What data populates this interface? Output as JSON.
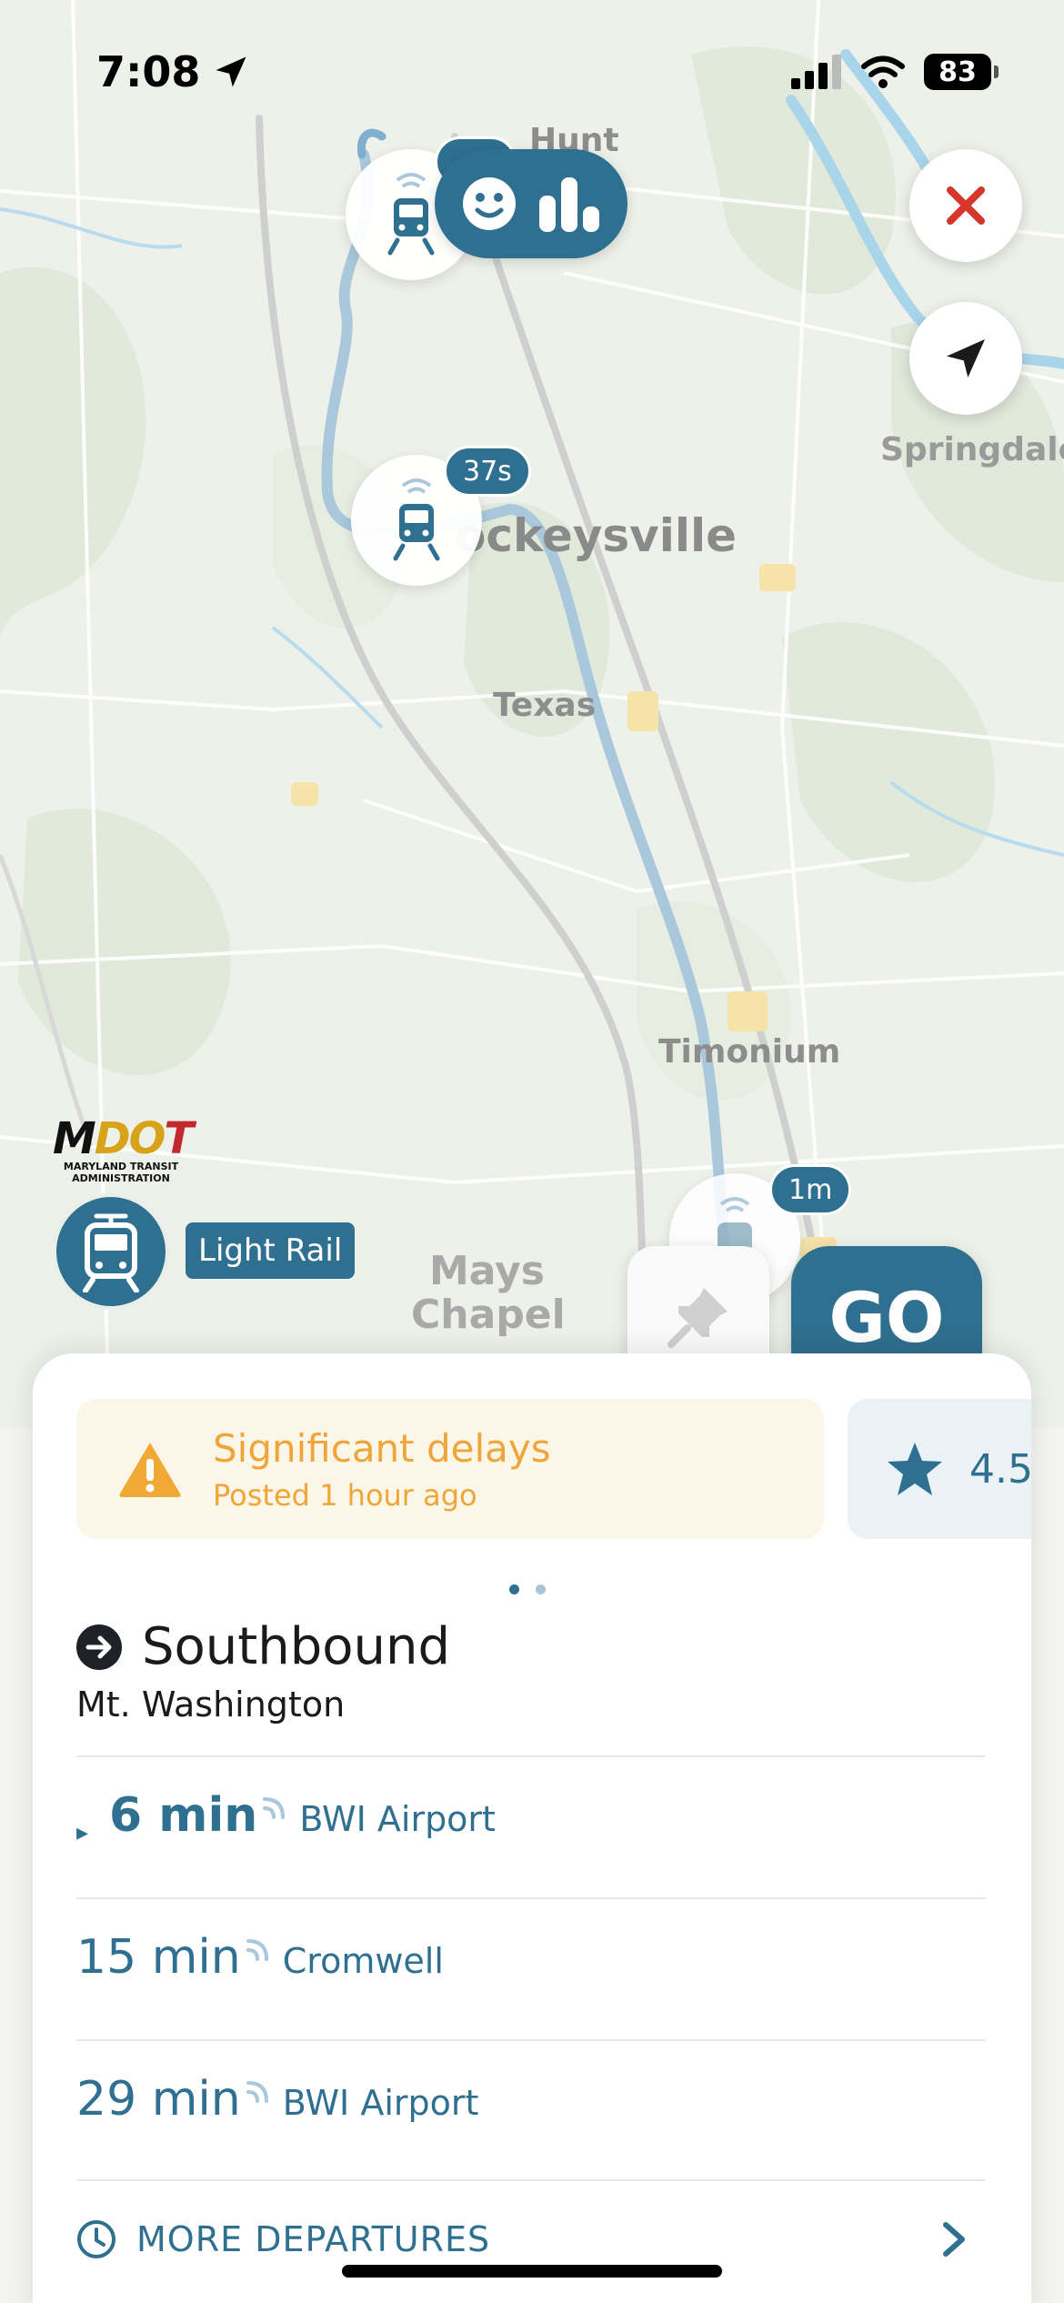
{
  "status_bar": {
    "time": "7:08",
    "battery": "83"
  },
  "map": {
    "places": {
      "hunt": "Hunt",
      "springdale": "Springdale",
      "cockeysville": "ockeysville",
      "texas": "Texas",
      "timonium": "Timonium",
      "mays": "Mays",
      "chapel": "Chapel"
    },
    "vehicles": [
      {
        "eta": ""
      },
      {
        "eta": "37s"
      },
      {
        "eta": "1m"
      }
    ],
    "operator_logo": {
      "mark_left": "M",
      "mark_mid": "D",
      "mark_o": "O",
      "mark_right": "T",
      "line1": "MARYLAND TRANSIT",
      "line2": "ADMINISTRATION"
    },
    "route_label": "Light Rail",
    "go_label": "GO",
    "icons": {
      "close": "close-icon",
      "locate": "location-arrow-icon",
      "crowd": "crowdsourcing-icon",
      "pin": "pushpin-icon",
      "tram": "tram-icon"
    },
    "colors": {
      "accent": "#2f6f8f",
      "route_line": "#a9c8dc",
      "close_red": "#d6352b"
    }
  },
  "sheet": {
    "alert": {
      "title": "Significant delays",
      "posted": "Posted 1 hour ago",
      "color": "#efa638"
    },
    "rating": {
      "value": "4.5"
    },
    "pager": {
      "count": 2,
      "active": 0
    },
    "direction": "Southbound",
    "stop": "Mt. Washington",
    "departures": [
      {
        "time": "6 min",
        "destination": "BWI Airport",
        "realtime": true
      },
      {
        "time": "15 min",
        "destination": "Cromwell",
        "realtime": true
      },
      {
        "time": "29 min",
        "destination": "BWI Airport",
        "realtime": true
      }
    ],
    "more_label": "MORE DEPARTURES"
  }
}
